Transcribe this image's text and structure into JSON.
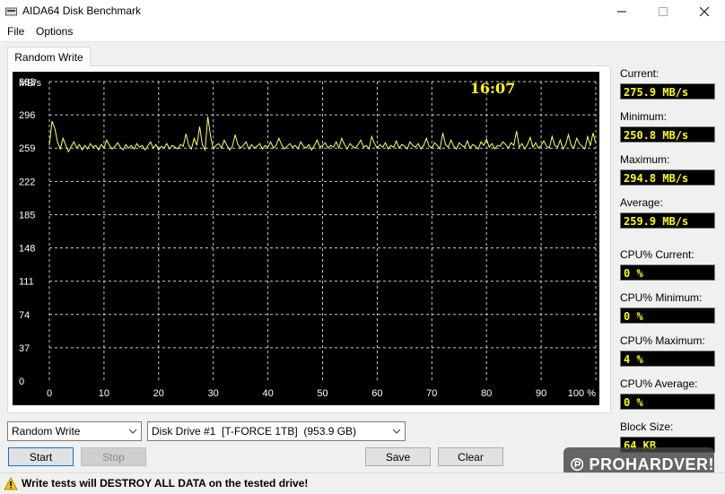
{
  "window": {
    "title": "AIDA64 Disk Benchmark"
  },
  "menu": {
    "items": [
      "File",
      "Options"
    ]
  },
  "tab": {
    "label": "Random Write"
  },
  "chart_data": {
    "type": "line",
    "ylabel": "MB/s",
    "y_ticks": [
      "333",
      "296",
      "259",
      "222",
      "185",
      "148",
      "111",
      "74",
      "37",
      "0"
    ],
    "ylim": [
      0,
      333
    ],
    "x_ticks": [
      "0",
      "10",
      "20",
      "30",
      "40",
      "50",
      "60",
      "70",
      "80",
      "90",
      "100 %"
    ],
    "xlim": [
      0,
      100
    ],
    "grid": true,
    "timer": "16:07",
    "line_color": "#ffff66",
    "series": [
      {
        "x": [
          0,
          0.5,
          1,
          1.5,
          2,
          2.5,
          3,
          3.5,
          4,
          4.5,
          5,
          5.5,
          6,
          6.5,
          7,
          7.5,
          8,
          8.5,
          9,
          9.5,
          10,
          10.5,
          11,
          11.5,
          12,
          12.5,
          13,
          13.5,
          14,
          14.5,
          15,
          15.5,
          16,
          16.5,
          17,
          17.5,
          18,
          18.5,
          19,
          19.5,
          20,
          20.5,
          21,
          21.5,
          22,
          22.5,
          23,
          23.5,
          24,
          24.5,
          25,
          25.5,
          26,
          26.5,
          27,
          27.5,
          28,
          28.5,
          29,
          29.5,
          30,
          30.5,
          31,
          31.5,
          32,
          32.5,
          33,
          33.5,
          34,
          34.5,
          35,
          35.5,
          36,
          36.5,
          37,
          37.5,
          38,
          38.5,
          39,
          39.5,
          40,
          40.5,
          41,
          41.5,
          42,
          42.5,
          43,
          43.5,
          44,
          44.5,
          45,
          45.5,
          46,
          46.5,
          47,
          47.5,
          48,
          48.5,
          49,
          49.5,
          50,
          50.5,
          51,
          51.5,
          52,
          52.5,
          53,
          53.5,
          54,
          54.5,
          55,
          55.5,
          56,
          56.5,
          57,
          57.5,
          58,
          58.5,
          59,
          59.5,
          60,
          60.5,
          61,
          61.5,
          62,
          62.5,
          63,
          63.5,
          64,
          64.5,
          65,
          65.5,
          66,
          66.5,
          67,
          67.5,
          68,
          68.5,
          69,
          69.5,
          70,
          70.5,
          71,
          71.5,
          72,
          72.5,
          73,
          73.5,
          74,
          74.5,
          75,
          75.5,
          76,
          76.5,
          77,
          77.5,
          78,
          78.5,
          79,
          79.5,
          80,
          80.5,
          81,
          81.5,
          82,
          82.5,
          83,
          83.5,
          84,
          84.5,
          85,
          85.5,
          86,
          86.5,
          87,
          87.5,
          88,
          88.5,
          89,
          89.5,
          90,
          90.5,
          91,
          91.5,
          92,
          92.5,
          93,
          93.5,
          94,
          94.5,
          95,
          95.5,
          96,
          96.5,
          97,
          97.5,
          98,
          98.5,
          99,
          99.5,
          100
        ],
        "y": [
          262,
          289,
          281,
          266,
          258,
          270,
          262,
          255,
          261,
          266,
          259,
          263,
          257,
          262,
          258,
          264,
          260,
          262,
          257,
          263,
          259,
          268,
          262,
          258,
          261,
          265,
          260,
          257,
          263,
          259,
          262,
          258,
          264,
          260,
          262,
          257,
          261,
          266,
          259,
          263,
          257,
          261,
          259,
          264,
          258,
          262,
          260,
          258,
          263,
          261,
          275,
          262,
          258,
          270,
          262,
          283,
          263,
          257,
          294,
          272,
          258,
          262,
          264,
          259,
          268,
          262,
          257,
          261,
          274,
          263,
          259,
          262,
          266,
          258,
          263,
          259,
          261,
          264,
          258,
          262,
          260,
          266,
          259,
          262,
          270,
          263,
          258,
          261,
          264,
          260,
          262,
          258,
          266,
          261,
          259,
          263,
          257,
          262,
          268,
          260,
          262,
          265,
          259,
          262,
          260,
          266,
          259,
          270,
          263,
          258,
          264,
          261,
          259,
          263,
          268,
          260,
          262,
          258,
          272,
          264,
          259,
          263,
          260,
          265,
          258,
          262,
          260,
          267,
          259,
          263,
          261,
          258,
          266,
          262,
          260,
          264,
          258,
          262,
          270,
          261,
          259,
          265,
          262,
          258,
          276,
          263,
          260,
          268,
          261,
          258,
          265,
          262,
          260,
          267,
          259,
          263,
          261,
          258,
          266,
          262,
          269,
          260,
          264,
          258,
          262,
          261,
          266,
          263,
          259,
          265,
          262,
          278,
          260,
          264,
          258,
          263,
          271,
          260,
          265,
          259,
          262,
          267,
          261,
          259,
          272,
          262,
          260,
          268,
          258,
          263,
          274,
          262,
          259,
          270,
          264,
          261,
          258,
          272,
          262,
          276,
          264
        ]
      }
    ]
  },
  "side": {
    "current_label": "Current:",
    "current_value": "275.9 MB/s",
    "minimum_label": "Minimum:",
    "minimum_value": "250.8 MB/s",
    "maximum_label": "Maximum:",
    "maximum_value": "294.8 MB/s",
    "average_label": "Average:",
    "average_value": "259.9 MB/s",
    "cpu_current_label": "CPU% Current:",
    "cpu_current_value": "0 %",
    "cpu_minimum_label": "CPU% Minimum:",
    "cpu_minimum_value": "0 %",
    "cpu_maximum_label": "CPU% Maximum:",
    "cpu_maximum_value": "4 %",
    "cpu_average_label": "CPU% Average:",
    "cpu_average_value": "0 %",
    "block_size_label": "Block Size:",
    "block_size_value": "64 KB"
  },
  "controls": {
    "test_select": "Random Write",
    "drive_select": "Disk Drive #1  [T-FORCE 1TB]  (953.9 GB)",
    "start": "Start",
    "stop": "Stop",
    "save": "Save",
    "clear": "Clear"
  },
  "status": {
    "warning": "Write tests will DESTROY ALL DATA on the tested drive!"
  },
  "watermark": {
    "text": "PROHARDVER!"
  }
}
